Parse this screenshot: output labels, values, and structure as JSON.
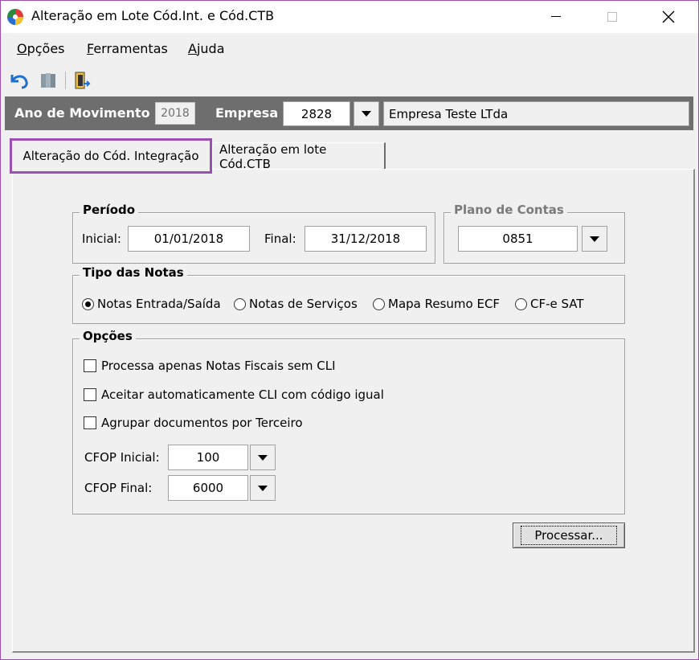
{
  "window": {
    "title": "Alteração em Lote Cód.Int. e Cód.CTB"
  },
  "menu": {
    "items": [
      {
        "accel": "O",
        "rest": "pções"
      },
      {
        "accel": "F",
        "rest": "erramentas"
      },
      {
        "accel": "A",
        "rest": "juda"
      }
    ]
  },
  "toolbar": {
    "icons": [
      "undo-icon",
      "book-icon",
      "exit-door-icon"
    ]
  },
  "header": {
    "ano_label": "Ano de Movimento",
    "ano_value": "2018",
    "empresa_label": "Empresa",
    "empresa_code": "2828",
    "empresa_name": "Empresa Teste LTda"
  },
  "tabs": [
    {
      "label": "Alteração do Cód. Integração",
      "active": true
    },
    {
      "label": "Alteração em lote Cód.CTB",
      "active": false
    }
  ],
  "periodo": {
    "title": "Período",
    "inicial_label": "Inicial:",
    "inicial_value": "01/01/2018",
    "final_label": "Final:",
    "final_value": "31/12/2018"
  },
  "plano": {
    "title": "Plano de Contas",
    "value": "0851"
  },
  "tipo_notas": {
    "title": "Tipo das Notas",
    "options": [
      {
        "label": "Notas Entrada/Saída",
        "selected": true
      },
      {
        "label": "Notas de Serviços",
        "selected": false
      },
      {
        "label": "Mapa Resumo ECF",
        "selected": false
      },
      {
        "label": "CF-e SAT",
        "selected": false
      }
    ]
  },
  "opcoes": {
    "title": "Opções",
    "checks": [
      {
        "label": "Processa apenas Notas Fiscais sem CLI",
        "checked": false
      },
      {
        "label": "Aceitar automaticamente CLI com código igual",
        "checked": false
      },
      {
        "label": "Agrupar documentos por Terceiro",
        "checked": false
      }
    ],
    "cfop_inicial_label": "CFOP Inicial:",
    "cfop_inicial_value": "100",
    "cfop_final_label": "CFOP Final:",
    "cfop_final_value": "6000"
  },
  "actions": {
    "processar_label": "Processar..."
  },
  "colors": {
    "highlight": "#9b4fb0",
    "header_bar": "#6e6e6e",
    "accent_blue": "#1f6fd1"
  }
}
